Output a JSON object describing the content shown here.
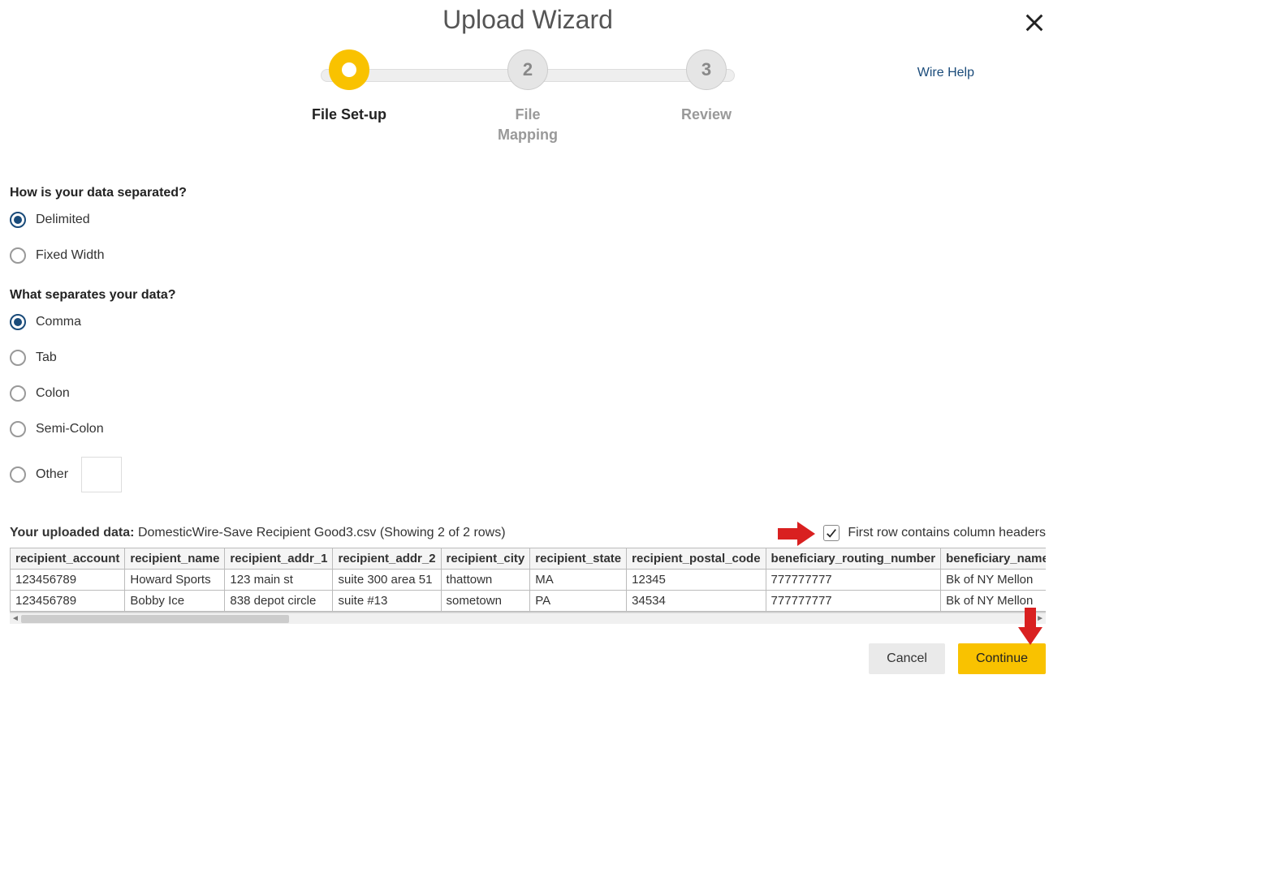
{
  "title": "Upload Wizard",
  "help_link": "Wire Help",
  "steps": [
    {
      "num": "",
      "label": "File Set-up",
      "active": true
    },
    {
      "num": "2",
      "label": "File\nMapping",
      "active": false
    },
    {
      "num": "3",
      "label": "Review",
      "active": false
    }
  ],
  "q1": {
    "prompt": "How is your data separated?",
    "options": [
      {
        "label": "Delimited",
        "selected": true
      },
      {
        "label": "Fixed Width",
        "selected": false
      }
    ]
  },
  "q2": {
    "prompt": "What separates your data?",
    "options": [
      {
        "label": "Comma",
        "selected": true
      },
      {
        "label": "Tab",
        "selected": false
      },
      {
        "label": "Colon",
        "selected": false
      },
      {
        "label": "Semi-Colon",
        "selected": false
      },
      {
        "label": "Other",
        "selected": false,
        "has_input": true,
        "input_value": ""
      }
    ]
  },
  "uploaded": {
    "prefix": "Your uploaded data: ",
    "filename": "DomesticWire-Save Recipient Good3.csv",
    "rows_note": " (Showing 2 of 2 rows)"
  },
  "header_checkbox": {
    "label": "First row contains column headers",
    "checked": true
  },
  "table": {
    "headers": [
      "recipient_account",
      "recipient_name",
      "recipient_addr_1",
      "recipient_addr_2",
      "recipient_city",
      "recipient_state",
      "recipient_postal_code",
      "beneficiary_routing_number",
      "beneficiary_name"
    ],
    "rows": [
      [
        "123456789",
        "Howard Sports",
        "123 main st",
        "suite 300 area 51",
        "thattown",
        "MA",
        "12345",
        "777777777",
        "Bk of NY Mellon"
      ],
      [
        "123456789",
        "Bobby Ice",
        "838 depot circle",
        "suite #13",
        "sometown",
        "PA",
        "34534",
        "777777777",
        "Bk of NY Mellon"
      ]
    ]
  },
  "buttons": {
    "cancel": "Cancel",
    "continue": "Continue"
  }
}
